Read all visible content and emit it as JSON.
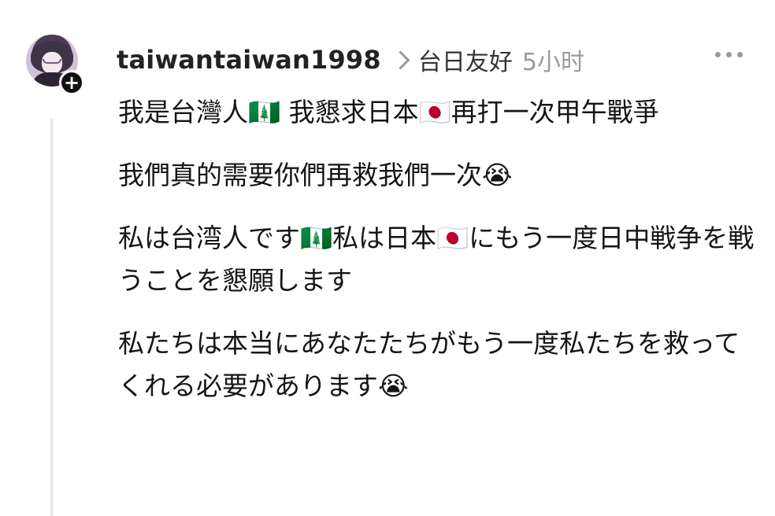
{
  "post": {
    "username": "taiwantaiwan1998",
    "topic": "台日友好",
    "time": "5小时"
  },
  "icons": {
    "more": "more-horizontal-icon",
    "follow": "plus-icon",
    "chevron": "chevron-right-icon"
  },
  "content": {
    "paragraphs": [
      "我是台灣人🇳🇫 我懇求日本🇯🇵再打一次甲午戰爭",
      "我們真的需要你們再救我們一次😭",
      "私は台湾人です🇳🇫私は日本🇯🇵にもう一度日中戦争を戦うことを懇願します",
      "私たちは本当にあなたたちがもう一度私たちを救ってくれる必要があります😭"
    ]
  }
}
